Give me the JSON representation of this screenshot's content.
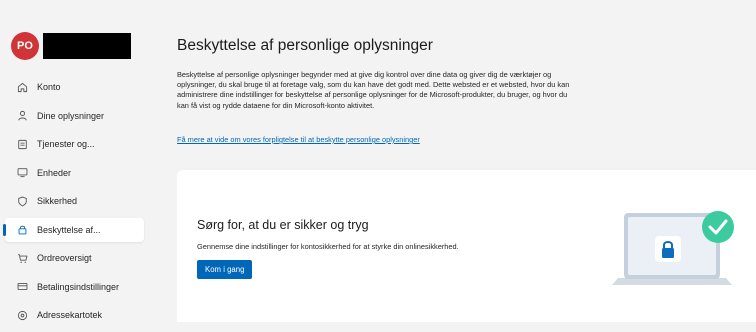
{
  "profile": {
    "initials": "PO"
  },
  "nav": [
    {
      "label": "Konto",
      "icon": "home-icon"
    },
    {
      "label": "Dine oplysninger",
      "icon": "person-icon"
    },
    {
      "label": "Tjenester og...",
      "icon": "subscriptions-icon"
    },
    {
      "label": "Enheder",
      "icon": "device-icon"
    },
    {
      "label": "Sikkerhed",
      "icon": "shield-icon"
    },
    {
      "label": "Beskyttelse af...",
      "icon": "lock-icon",
      "active": true
    },
    {
      "label": "Ordreoversigt",
      "icon": "cart-icon"
    },
    {
      "label": "Betalingsindstillinger",
      "icon": "credit-card-icon"
    },
    {
      "label": "Adressekartotek",
      "icon": "location-icon"
    }
  ],
  "page": {
    "title": "Beskyttelse af personlige oplysninger",
    "description": "Beskyttelse af personlige oplysninger begynder med at give dig kontrol over dine data og giver dig de værktøjer og oplysninger, du skal bruge til at foretage valg, som du kan have det godt med. Dette websted er et websted, hvor du kan administrere dine indstillinger for beskyttelse af personlige oplysninger for de Microsoft-produkter, du bruger, og hvor du kan få vist og rydde dataene for din Microsoft-konto aktivitet.",
    "link": "Få mere at vide om vores forpligtelse til at beskytte personlige oplysninger"
  },
  "card": {
    "title": "Sørg for, at du er sikker og tryg",
    "subtitle": "Gennemse dine indstillinger for kontosikkerhed for at styrke din onlinesikkerhed.",
    "button": "Kom i gang"
  },
  "colors": {
    "accent": "#0067b8",
    "avatar": "#d13438",
    "check": "#3ccb9f"
  }
}
